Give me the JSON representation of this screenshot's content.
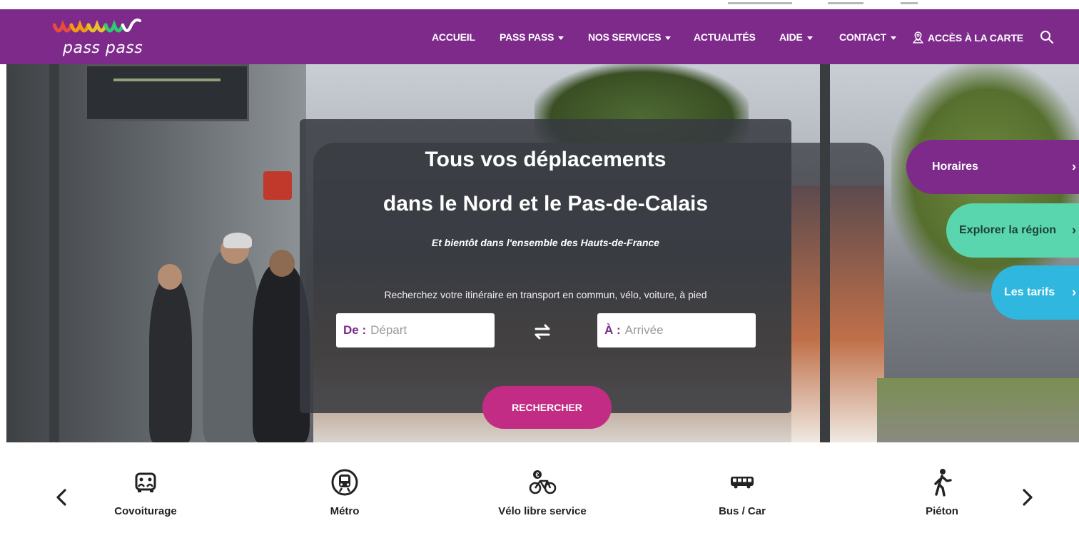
{
  "header": {
    "logo_text": "pass pass",
    "menu": [
      {
        "label": "ACCUEIL",
        "has_dropdown": false
      },
      {
        "label": "PASS PASS",
        "has_dropdown": true
      },
      {
        "label": "NOS SERVICES",
        "has_dropdown": true
      },
      {
        "label": "ACTUALITÉS",
        "has_dropdown": false
      },
      {
        "label": "AIDE",
        "has_dropdown": true
      },
      {
        "label": "CONTACT",
        "has_dropdown": true
      },
      {
        "label": "ACCÈS À LA CARTE",
        "has_dropdown": false,
        "icon": "map-pin-icon"
      }
    ],
    "search_icon": "search-icon"
  },
  "hero": {
    "title_line1": "Tous vos déplacements",
    "title_line2": "dans le Nord et le Pas-de-Calais",
    "subtitle": "Et bientôt dans l'ensemble des Hauts-de-France",
    "helper_text": "Recherchez votre itinéraire en transport en commun, vélo, voiture, à pied",
    "from": {
      "label": "De :",
      "placeholder": "Départ"
    },
    "to": {
      "label": "À :",
      "placeholder": "Arrivée"
    },
    "swap_icon": "swap-arrows-icon",
    "search_button": "RECHERCHER"
  },
  "side_tabs": [
    {
      "label": "Horaires",
      "color": "#7d2a8b"
    },
    {
      "label": "Explorer la région",
      "color": "#5ad6ae"
    },
    {
      "label": "Les tarifs",
      "color": "#2fb7df"
    }
  ],
  "modes": {
    "prev_icon": "chevron-left-icon",
    "next_icon": "chevron-right-icon",
    "items": [
      {
        "label": "Covoiturage",
        "icon": "carpool-icon"
      },
      {
        "label": "Métro",
        "icon": "metro-icon"
      },
      {
        "label": "Vélo libre service",
        "icon": "bike-share-icon"
      },
      {
        "label": "Bus / Car",
        "icon": "bus-icon"
      },
      {
        "label": "Piéton",
        "icon": "pedestrian-icon"
      }
    ]
  },
  "colors": {
    "brand_purple": "#7d2a8b",
    "button_magenta": "#c32c84",
    "teal": "#5ad6ae",
    "blue": "#2fb7df"
  }
}
